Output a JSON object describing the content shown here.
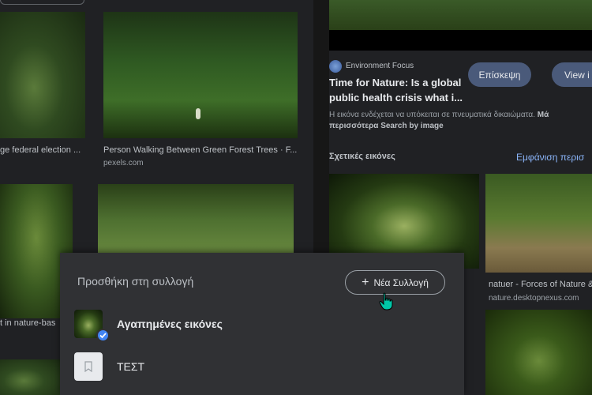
{
  "left_grid": {
    "tiles": [
      {
        "caption": "ge federal election ...",
        "source": ""
      },
      {
        "caption": "Person Walking Between Green Forest Trees · F...",
        "source": "pexels.com"
      }
    ],
    "bottom_left_caption": "t in nature-bas"
  },
  "detail": {
    "source_name": "Environment Focus",
    "title_line1": "Time for Nature: Is a global",
    "title_line2": "public health crisis what i...",
    "visit_button": "Επίσκεψη",
    "view_button": "View i",
    "license_text": "Η εικόνα ενδέχεται να υπόκειται σε πνευματικά δικαιώματα.",
    "license_link1": "Μά",
    "license_link2": "περισσότερα",
    "search_by_image": "Search by image",
    "related_heading": "Σχετικές εικόνες",
    "show_more": "Εμφάνιση περισ"
  },
  "related": [
    {
      "caption": "natuer - Forces of Nature &",
      "source": "nature.desktopnexus.com"
    }
  ],
  "collection_panel": {
    "title": "Προσθήκη στη συλλογή",
    "new_collection_label": "Νέα Συλλογή",
    "items": [
      {
        "label": "Αγαπημένες εικόνες",
        "icon": "checkmark-icon"
      },
      {
        "label": "ΤΕΣΤ",
        "icon": "bookmark-icon"
      }
    ]
  },
  "colors": {
    "background": "#202124",
    "panel": "#303134",
    "accent_blue": "#8ab4f8",
    "check_badge": "#4285f4",
    "cursor": "#00c8a8"
  }
}
